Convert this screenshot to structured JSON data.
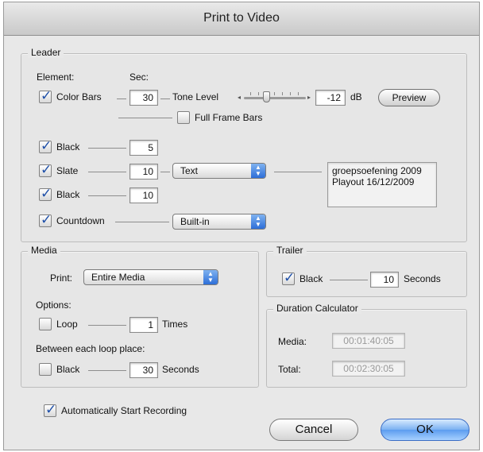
{
  "window": {
    "title": "Print to Video"
  },
  "leader": {
    "title": "Leader",
    "element_header": "Element:",
    "sec_header": "Sec:",
    "color_bars": {
      "label": "Color Bars",
      "checked": true,
      "seconds": "30"
    },
    "tone_level": {
      "label": "Tone Level",
      "value": "-12",
      "unit": "dB"
    },
    "preview_button": "Preview",
    "full_frame_bars": {
      "label": "Full Frame Bars",
      "checked": false
    },
    "black1": {
      "label": "Black",
      "checked": true,
      "seconds": "5"
    },
    "slate": {
      "label": "Slate",
      "checked": true,
      "seconds": "10",
      "source": "Text",
      "text": "groepsoefening 2009\nPlayout 16/12/2009"
    },
    "black2": {
      "label": "Black",
      "checked": true,
      "seconds": "10"
    },
    "countdown": {
      "label": "Countdown",
      "checked": true,
      "source": "Built-in"
    }
  },
  "media": {
    "title": "Media",
    "print_label": "Print:",
    "print_value": "Entire Media",
    "options_label": "Options:",
    "loop": {
      "label": "Loop",
      "checked": false,
      "times": "1",
      "times_label": "Times"
    },
    "between_label": "Between each loop place:",
    "black": {
      "label": "Black",
      "checked": false,
      "seconds": "30",
      "seconds_label": "Seconds"
    }
  },
  "trailer": {
    "title": "Trailer",
    "black": {
      "label": "Black",
      "checked": true,
      "seconds": "10",
      "seconds_label": "Seconds"
    }
  },
  "duration": {
    "title": "Duration Calculator",
    "media_label": "Media:",
    "media_value": "00:01:40:05",
    "total_label": "Total:",
    "total_value": "00:02:30:05"
  },
  "auto_start": {
    "label": "Automatically Start Recording",
    "checked": true
  },
  "buttons": {
    "cancel": "Cancel",
    "ok": "OK"
  },
  "colors": {
    "accent": "#2d6ed8",
    "check": "#1e4fa8"
  }
}
